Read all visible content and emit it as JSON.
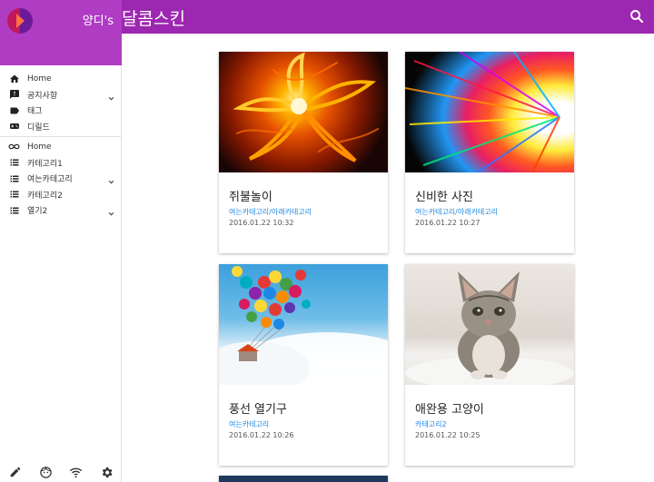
{
  "app": {
    "brand_title": "양디's",
    "page_title": "달콤스킨"
  },
  "colors": {
    "primary": "#9c27b0",
    "brand_bg": "#b03cc4",
    "link": "#1e88e5"
  },
  "sidebar": {
    "top_items": [
      {
        "label": "Home",
        "icon": "home-icon"
      },
      {
        "label": "공지사항",
        "icon": "announcement-icon",
        "expandable": true
      },
      {
        "label": "태그",
        "icon": "tag-icon"
      },
      {
        "label": "디릴드",
        "icon": "gamepad-icon"
      }
    ],
    "bottom_items": [
      {
        "label": "Home",
        "icon": "infinity-icon"
      },
      {
        "label": "카테고리1",
        "icon": "list-icon"
      },
      {
        "label": "여는카테고리",
        "icon": "list-icon",
        "expandable": true
      },
      {
        "label": "카테고리2",
        "icon": "list-icon"
      },
      {
        "label": "열기2",
        "icon": "list-icon",
        "expandable": true
      }
    ],
    "tools": [
      "edit-icon",
      "face-icon",
      "wifi-icon",
      "settings-icon"
    ]
  },
  "posts": [
    {
      "title": "쥐불놀이",
      "category": "여는카테고리/아래카테고리",
      "date": "2016.01.22 10:32",
      "image": "fire-flower-image"
    },
    {
      "title": "신비한 사진",
      "category": "여는카테고리/아래카테고리",
      "date": "2016.01.22 10:27",
      "image": "color-burst-image"
    },
    {
      "title": "풍선 열기구",
      "category": "여는카테고리",
      "date": "2016.01.22 10:26",
      "image": "balloon-house-image"
    },
    {
      "title": "애완용 고양이",
      "category": "카테고리2",
      "date": "2016.01.22 10:25",
      "image": "kitten-image"
    }
  ]
}
